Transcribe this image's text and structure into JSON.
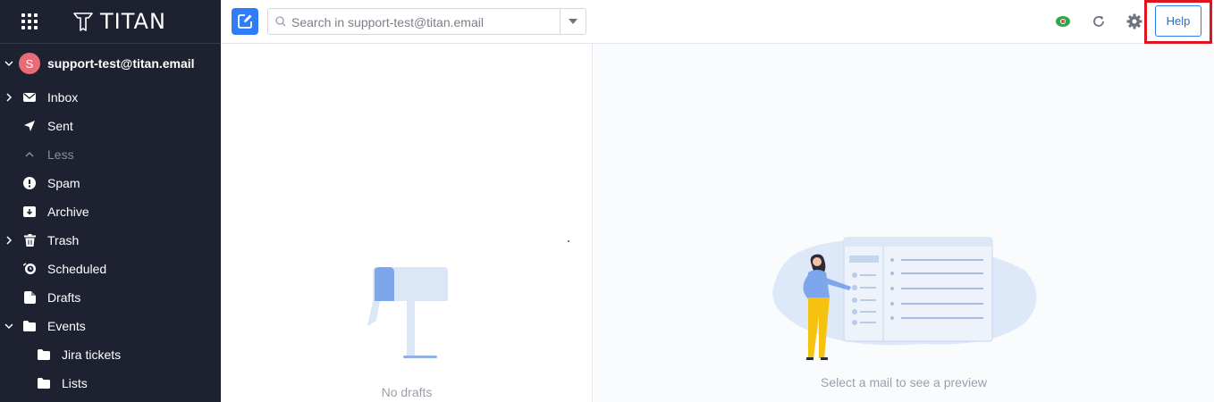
{
  "brand": {
    "name": "TITAN"
  },
  "account": {
    "initial": "S",
    "email": "support-test@titan.email"
  },
  "sidebar": {
    "items": [
      {
        "label": "Inbox",
        "icon": "envelope-icon",
        "arrow": "chevron-right"
      },
      {
        "label": "Sent",
        "icon": "paper-plane-icon"
      },
      {
        "label": "Less",
        "icon": "chevron-up-icon"
      },
      {
        "label": "Spam",
        "icon": "exclamation-circle-icon"
      },
      {
        "label": "Archive",
        "icon": "archive-icon"
      },
      {
        "label": "Trash",
        "icon": "trash-icon",
        "arrow": "chevron-right"
      },
      {
        "label": "Scheduled",
        "icon": "clock-icon"
      },
      {
        "label": "Drafts",
        "icon": "drafts-icon"
      },
      {
        "label": "Events",
        "icon": "folder-icon",
        "arrow": "chevron-down"
      },
      {
        "label": "Jira tickets",
        "icon": "folder-icon"
      },
      {
        "label": "Lists",
        "icon": "folder-icon"
      }
    ]
  },
  "search": {
    "placeholder": "Search in support-test@titan.email"
  },
  "toolbar": {
    "help_label": "Help"
  },
  "list": {
    "empty_text": "No drafts"
  },
  "preview": {
    "empty_text": "Select a mail to see a preview"
  },
  "colors": {
    "sidebar_bg": "#1e2130",
    "accent": "#2e7cf6",
    "highlight": "#e0141e"
  }
}
